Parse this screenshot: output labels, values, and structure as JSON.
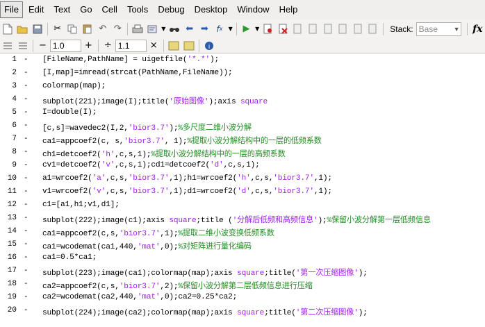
{
  "menubar": {
    "items": [
      "File",
      "Edit",
      "Text",
      "Go",
      "Cell",
      "Tools",
      "Debug",
      "Desktop",
      "Window",
      "Help"
    ]
  },
  "toolbar": {
    "stack_label": "Stack:",
    "stack_value": "Base",
    "fx_label": "fx",
    "cell_value1": "1.0",
    "cell_value2": "1.1",
    "minus": "−",
    "plus": "+",
    "divide": "÷",
    "times": "×"
  },
  "code_lines": [
    {
      "n": "1",
      "segments": [
        [
          "t",
          "[FileName,PathName] = uigetfile("
        ],
        [
          "s",
          "'*.*'"
        ],
        [
          "t",
          ");"
        ]
      ]
    },
    {
      "n": "2",
      "segments": [
        [
          "t",
          "[I,map]=imread(strcat(PathName,FileName));"
        ]
      ]
    },
    {
      "n": "3",
      "segments": [
        [
          "t",
          "colormap(map);"
        ]
      ]
    },
    {
      "n": "4",
      "segments": [
        [
          "t",
          "subplot(221);image(I);title("
        ],
        [
          "s",
          "'原始图像'"
        ],
        [
          "t",
          ");axis "
        ],
        [
          "s",
          "square"
        ]
      ]
    },
    {
      "n": "5",
      "segments": [
        [
          "t",
          "I=double(I);"
        ]
      ]
    },
    {
      "n": "6",
      "segments": [
        [
          "t",
          "[c,s]=wavedec2(I,2,"
        ],
        [
          "s",
          "'bior3.7'"
        ],
        [
          "t",
          ");"
        ],
        [
          "c",
          "%多尺度二维小波分解"
        ]
      ]
    },
    {
      "n": "7",
      "segments": [
        [
          "t",
          "ca1=appcoef2(c, s,"
        ],
        [
          "s",
          "'bior3.7'"
        ],
        [
          "t",
          ", 1);"
        ],
        [
          "c",
          "%提取小波分解结构中的一层的低频系数"
        ]
      ]
    },
    {
      "n": "8",
      "segments": [
        [
          "t",
          "ch1=detcoef2("
        ],
        [
          "s",
          "'h'"
        ],
        [
          "t",
          ",c,s,1);"
        ],
        [
          "c",
          "%提取小波分解结构中的一层的高频系数"
        ]
      ]
    },
    {
      "n": "9",
      "segments": [
        [
          "t",
          "cv1=detcoef2("
        ],
        [
          "s",
          "'v'"
        ],
        [
          "t",
          ",c,s,1);cd1=detcoef2("
        ],
        [
          "s",
          "'d'"
        ],
        [
          "t",
          ",c,s,1);"
        ]
      ]
    },
    {
      "n": "10",
      "segments": [
        [
          "t",
          "a1=wrcoef2("
        ],
        [
          "s",
          "'a'"
        ],
        [
          "t",
          ",c,s,"
        ],
        [
          "s",
          "'bior3.7'"
        ],
        [
          "t",
          ",1);h1=wrcoef2("
        ],
        [
          "s",
          "'h'"
        ],
        [
          "t",
          ",c,s,"
        ],
        [
          "s",
          "'bior3.7'"
        ],
        [
          "t",
          ",1);"
        ]
      ]
    },
    {
      "n": "11",
      "segments": [
        [
          "t",
          "v1=wrcoef2("
        ],
        [
          "s",
          "'v'"
        ],
        [
          "t",
          ",c,s,"
        ],
        [
          "s",
          "'bior3.7'"
        ],
        [
          "t",
          ",1);d1=wrcoef2("
        ],
        [
          "s",
          "'d'"
        ],
        [
          "t",
          ",c,s,"
        ],
        [
          "s",
          "'bior3.7'"
        ],
        [
          "t",
          ",1);"
        ]
      ]
    },
    {
      "n": "12",
      "segments": [
        [
          "t",
          "c1=[a1,h1;v1,d1];"
        ]
      ]
    },
    {
      "n": "13",
      "segments": [
        [
          "t",
          "subplot(222);image(c1);axis "
        ],
        [
          "s",
          "square"
        ],
        [
          "t",
          ";title ("
        ],
        [
          "s",
          "'分解后低频和高频信息'"
        ],
        [
          "t",
          ");"
        ],
        [
          "c",
          "%保留小波分解第一层低频信息"
        ]
      ]
    },
    {
      "n": "14",
      "segments": [
        [
          "t",
          "ca1=appcoef2(c,s,"
        ],
        [
          "s",
          "'bior3.7'"
        ],
        [
          "t",
          ",1);"
        ],
        [
          "c",
          "%提取二维小波变换低频系数"
        ]
      ]
    },
    {
      "n": "15",
      "segments": [
        [
          "t",
          "ca1=wcodemat(ca1,440,"
        ],
        [
          "s",
          "'mat'"
        ],
        [
          "t",
          ",0);"
        ],
        [
          "c",
          "%对矩阵进行量化编码"
        ]
      ]
    },
    {
      "n": "16",
      "segments": [
        [
          "t",
          "ca1=0.5*ca1;"
        ]
      ]
    },
    {
      "n": "17",
      "segments": [
        [
          "t",
          "subplot(223);image(ca1);colormap(map);axis "
        ],
        [
          "s",
          "square"
        ],
        [
          "t",
          ";title("
        ],
        [
          "s",
          "'第一次压缩图像'"
        ],
        [
          "t",
          ");"
        ]
      ]
    },
    {
      "n": "18",
      "segments": [
        [
          "t",
          "ca2=appcoef2(c,s,"
        ],
        [
          "s",
          "'bior3.7'"
        ],
        [
          "t",
          ",2);"
        ],
        [
          "c",
          "%保留小波分解第二层低频信息进行压缩"
        ]
      ]
    },
    {
      "n": "19",
      "segments": [
        [
          "t",
          "ca2=wcodemat(ca2,440,"
        ],
        [
          "s",
          "'mat'"
        ],
        [
          "t",
          ",0);ca2=0.25*ca2;"
        ]
      ]
    },
    {
      "n": "20",
      "segments": [
        [
          "t",
          "subplot(224);image(ca2);colormap(map);axis "
        ],
        [
          "s",
          "square"
        ],
        [
          "t",
          ";title("
        ],
        [
          "s",
          "'第二次压缩图像'"
        ],
        [
          "t",
          ");"
        ]
      ]
    }
  ],
  "colors": {
    "keyword": "#0000ff",
    "string": "#a020f0",
    "comment": "#228b22"
  }
}
